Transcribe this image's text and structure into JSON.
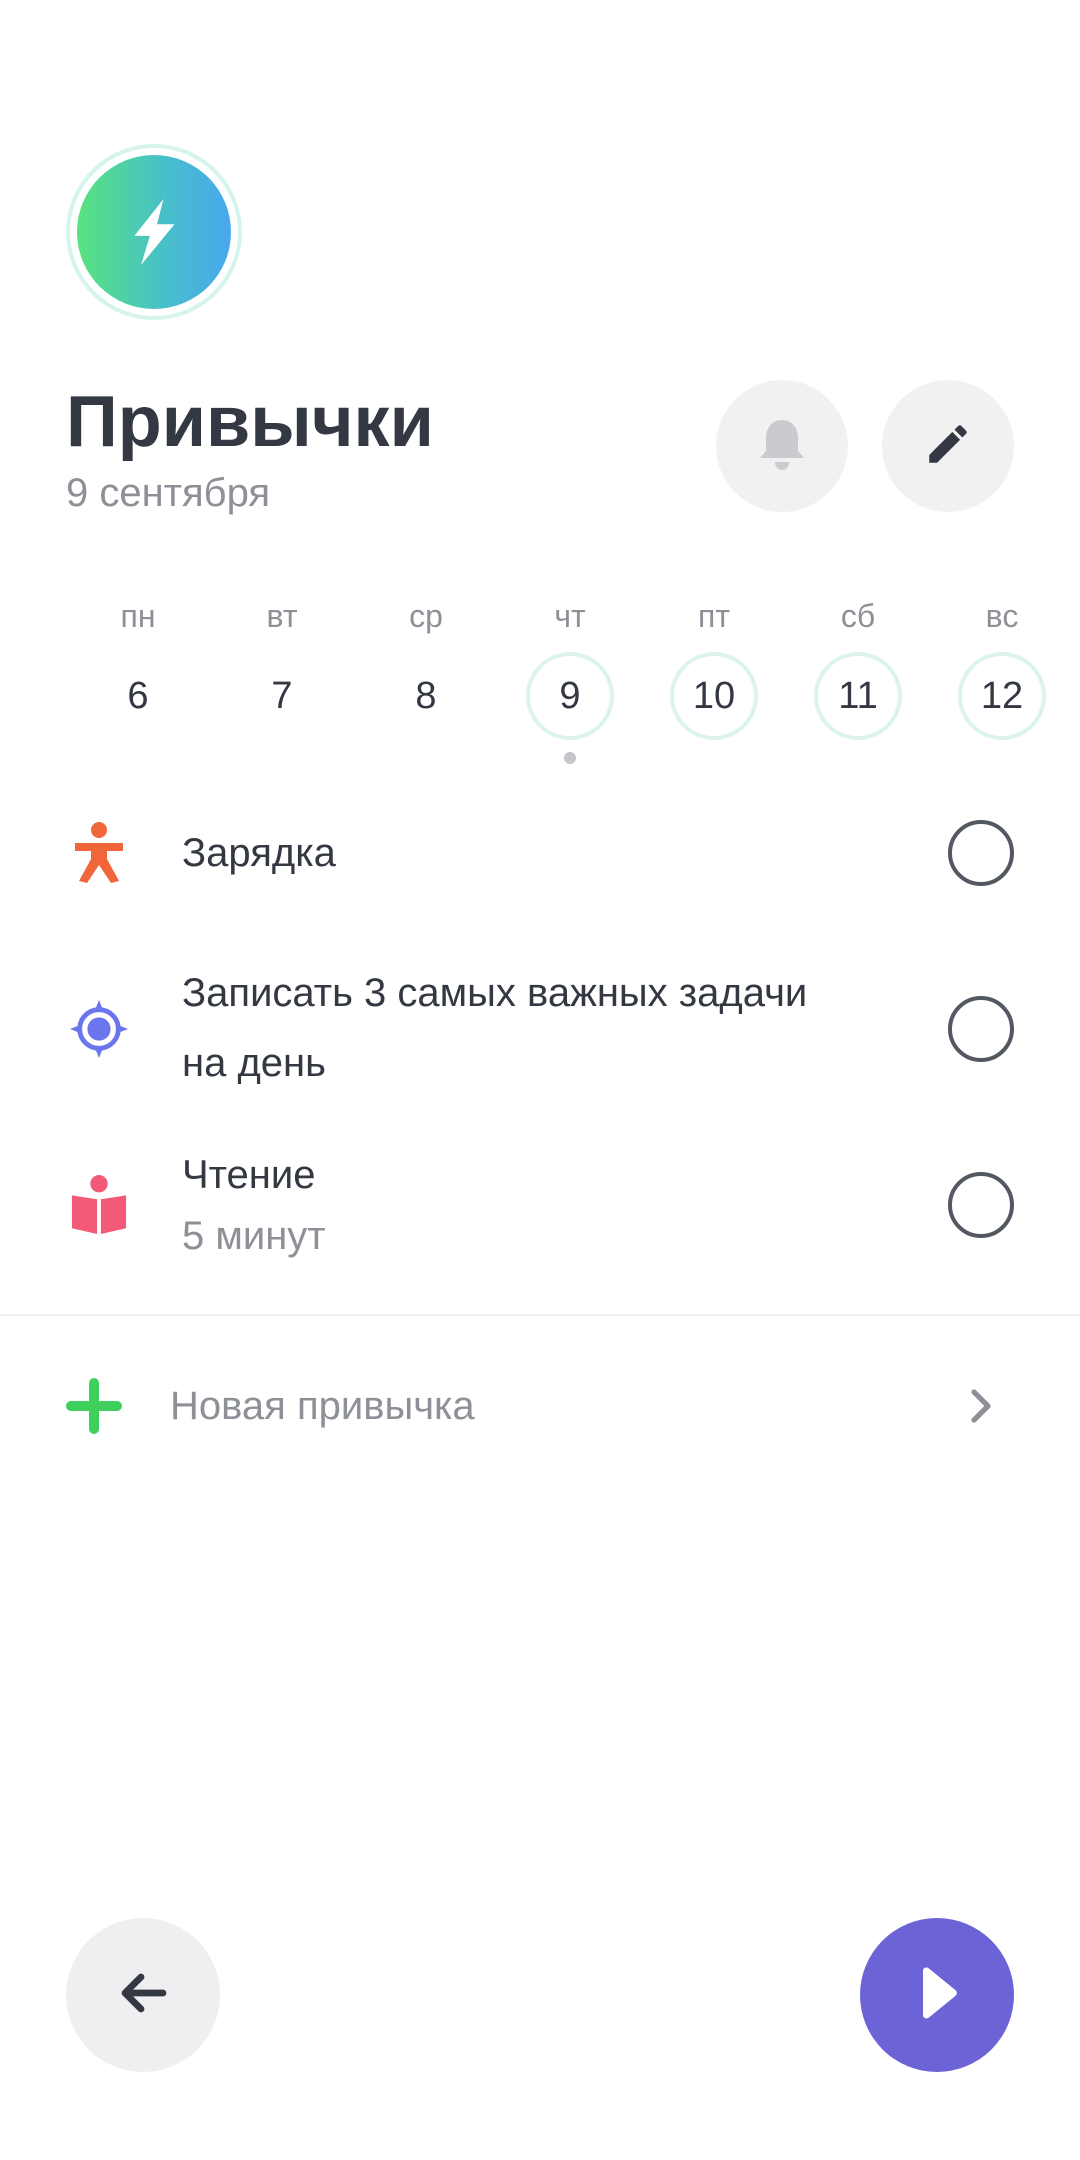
{
  "header": {
    "title": "Привычки",
    "date": "9 сентября"
  },
  "week": [
    {
      "dow": "пн",
      "num": "6",
      "ring": false
    },
    {
      "dow": "вт",
      "num": "7",
      "ring": false
    },
    {
      "dow": "ср",
      "num": "8",
      "ring": false
    },
    {
      "dow": "чт",
      "num": "9",
      "ring": true
    },
    {
      "dow": "пт",
      "num": "10",
      "ring": true
    },
    {
      "dow": "сб",
      "num": "11",
      "ring": true
    },
    {
      "dow": "вс",
      "num": "12",
      "ring": true
    }
  ],
  "habits": [
    {
      "title": "Зарядка",
      "icon": "exercise-person-icon",
      "color": "#f0663a",
      "checked": false
    },
    {
      "title_line1": "Записать 3 самых важных задачи",
      "title_line2": "на день",
      "icon": "target-icon",
      "color": "#6a75ee",
      "checked": false
    },
    {
      "title": "Чтение",
      "subtitle": "5 минут",
      "icon": "reading-book-icon",
      "color": "#f25a78",
      "checked": false
    }
  ],
  "new_habit": {
    "label": "Новая привычка"
  },
  "colors": {
    "accent": "#6c63d6",
    "plus": "#3fcf5c",
    "text": "#333842",
    "muted": "#8e9098"
  }
}
